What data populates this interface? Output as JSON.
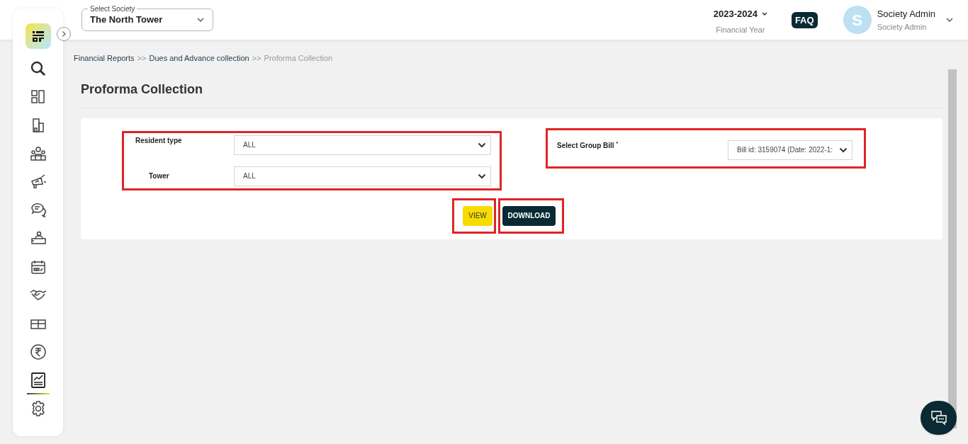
{
  "header": {
    "society_select": {
      "label": "Select Society",
      "value": "The North Tower"
    },
    "financial_year": {
      "value": "2023-2024",
      "caption": "Financial Year"
    },
    "faq": "FAQ",
    "user": {
      "initial": "S",
      "name": "Society Admin",
      "role": "Society Admin"
    }
  },
  "sidebar": {
    "items": [
      {
        "kind": "search",
        "selected": false
      },
      {
        "kind": "dashboard",
        "selected": false
      },
      {
        "kind": "building",
        "selected": false
      },
      {
        "kind": "people",
        "selected": false
      },
      {
        "kind": "announce",
        "selected": false
      },
      {
        "kind": "chat",
        "selected": false
      },
      {
        "kind": "helpdesk",
        "selected": false
      },
      {
        "kind": "calendar",
        "selected": false
      },
      {
        "kind": "handshake",
        "selected": false
      },
      {
        "kind": "box",
        "selected": false
      },
      {
        "kind": "rupee",
        "selected": false
      },
      {
        "kind": "report",
        "selected": true
      },
      {
        "kind": "settings",
        "selected": false
      }
    ]
  },
  "breadcrumb": [
    {
      "label": "Financial Reports",
      "current": false
    },
    {
      "label": "Dues and Advance collection",
      "current": false
    },
    {
      "label": "Proforma Collection",
      "current": true
    }
  ],
  "breadcrumb_separator": ">>",
  "page_title": "Proforma Collection",
  "filters": {
    "highlighted": true,
    "fields": [
      {
        "label": "Resident type",
        "value": "ALL"
      },
      {
        "label": "Tower",
        "value": "ALL"
      }
    ]
  },
  "group_bill": {
    "highlighted": true,
    "label": "Select Group Bill",
    "required_mark": "*",
    "value": "Bill id: 3159074 (Date: 2022-1:"
  },
  "buttons": [
    {
      "label": "VIEW",
      "kind": "primary",
      "highlighted": true
    },
    {
      "label": "DOWNLOAD",
      "kind": "dark",
      "highlighted": true
    }
  ]
}
